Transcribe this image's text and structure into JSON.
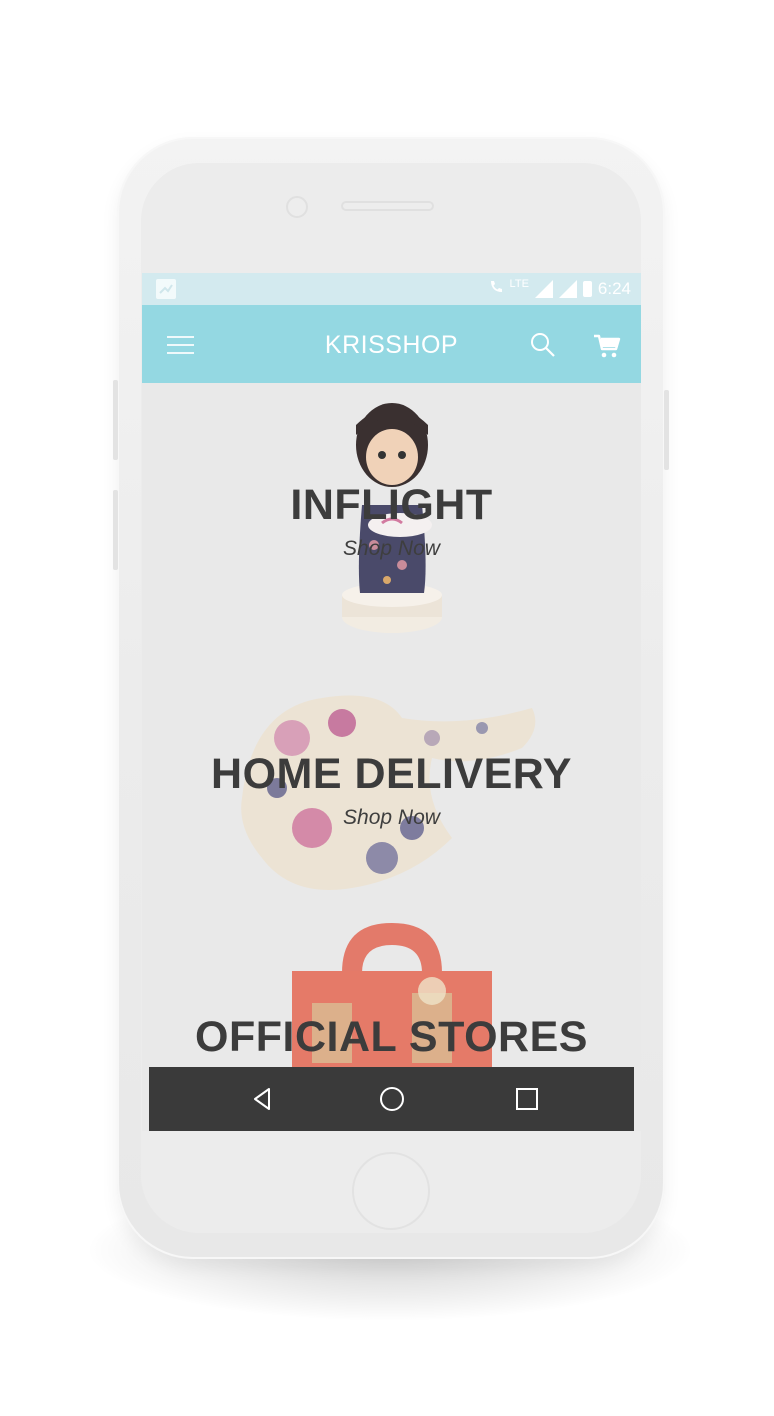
{
  "status_bar": {
    "network": "LTE",
    "time": "6:24"
  },
  "app_bar": {
    "title": "KRISSHOP",
    "icons": [
      "menu-icon",
      "search-icon",
      "cart-icon"
    ]
  },
  "banners": [
    {
      "title": "INFLIGHT",
      "subtitle": "Shop Now",
      "image": "figurine-doll"
    },
    {
      "title": "HOME DELIVERY",
      "subtitle": "Shop Now",
      "image": "floral-scarf"
    },
    {
      "title": "OFFICIAL STORES",
      "subtitle": "",
      "image": "red-tote-bag"
    }
  ],
  "nav_bar": {
    "buttons": [
      "back-icon",
      "home-icon",
      "recents-icon"
    ]
  },
  "colors": {
    "app_bar": "#94d8e2",
    "status_bar": "#d3eaef",
    "nav_bar": "#3a3a3a",
    "phone_body": "#eeeeee"
  }
}
